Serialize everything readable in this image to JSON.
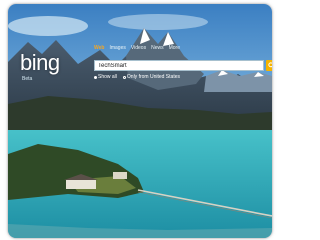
{
  "app": {
    "logo_text": "bing",
    "logo_sub": "Beta"
  },
  "nav": {
    "items": [
      "Web",
      "Images",
      "Videos",
      "News",
      "More"
    ],
    "active_index": 0
  },
  "search": {
    "value": "TechSmart",
    "placeholder": ""
  },
  "options": [
    "Show all",
    "Only from United States"
  ],
  "colors": {
    "accent": "#f5a623",
    "go_button": "#f5b400",
    "lake": "#3cb7c2",
    "sky_top": "#3d8fcf"
  },
  "icons": {
    "go": "search-go-icon"
  }
}
